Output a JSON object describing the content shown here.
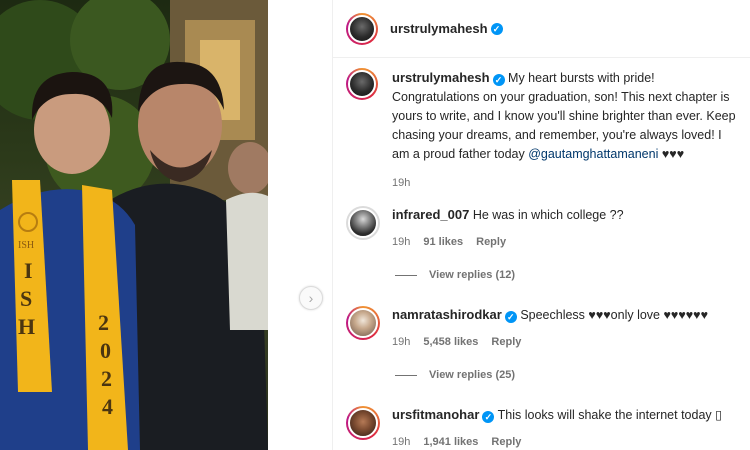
{
  "post": {
    "author": "urstrulymahesh",
    "caption": {
      "username": "urstrulymahesh",
      "text": "My heart bursts with pride! Congratulations on your graduation, son! This next chapter is yours to write, and I know you'll shine brighter than ever. Keep chasing your dreams, and remember, you're always loved! I am a proud father today",
      "mention": "@gautamghattamaneni",
      "hearts": "♥♥♥",
      "time": "19h"
    },
    "photo": {
      "sash_letters": [
        "I",
        "S",
        "H"
      ],
      "sash_year": [
        "2",
        "0",
        "2",
        "4"
      ],
      "sash_emblem": "ISH"
    }
  },
  "comments": [
    {
      "username": "infrared_007",
      "verified": false,
      "text": "He was in which college ??",
      "time": "19h",
      "likes": "91 likes",
      "reply": "Reply",
      "view_replies": "View replies (12)"
    },
    {
      "username": "namratashirodkar",
      "verified": true,
      "text": "Speechless ♥♥♥only love ♥♥♥♥♥♥",
      "time": "19h",
      "likes": "5,458 likes",
      "reply": "Reply",
      "view_replies": "View replies (25)"
    },
    {
      "username": "ursfitmanohar",
      "verified": true,
      "text": "This looks will shake the internet today ▯",
      "time": "19h",
      "likes": "1,941 likes",
      "reply": "Reply"
    }
  ],
  "icons": {
    "verified": "verified-badge-icon",
    "next": "chevron-right-icon"
  },
  "colors": {
    "accent": "#0095f6",
    "mention": "#00376b",
    "muted": "#737373"
  }
}
